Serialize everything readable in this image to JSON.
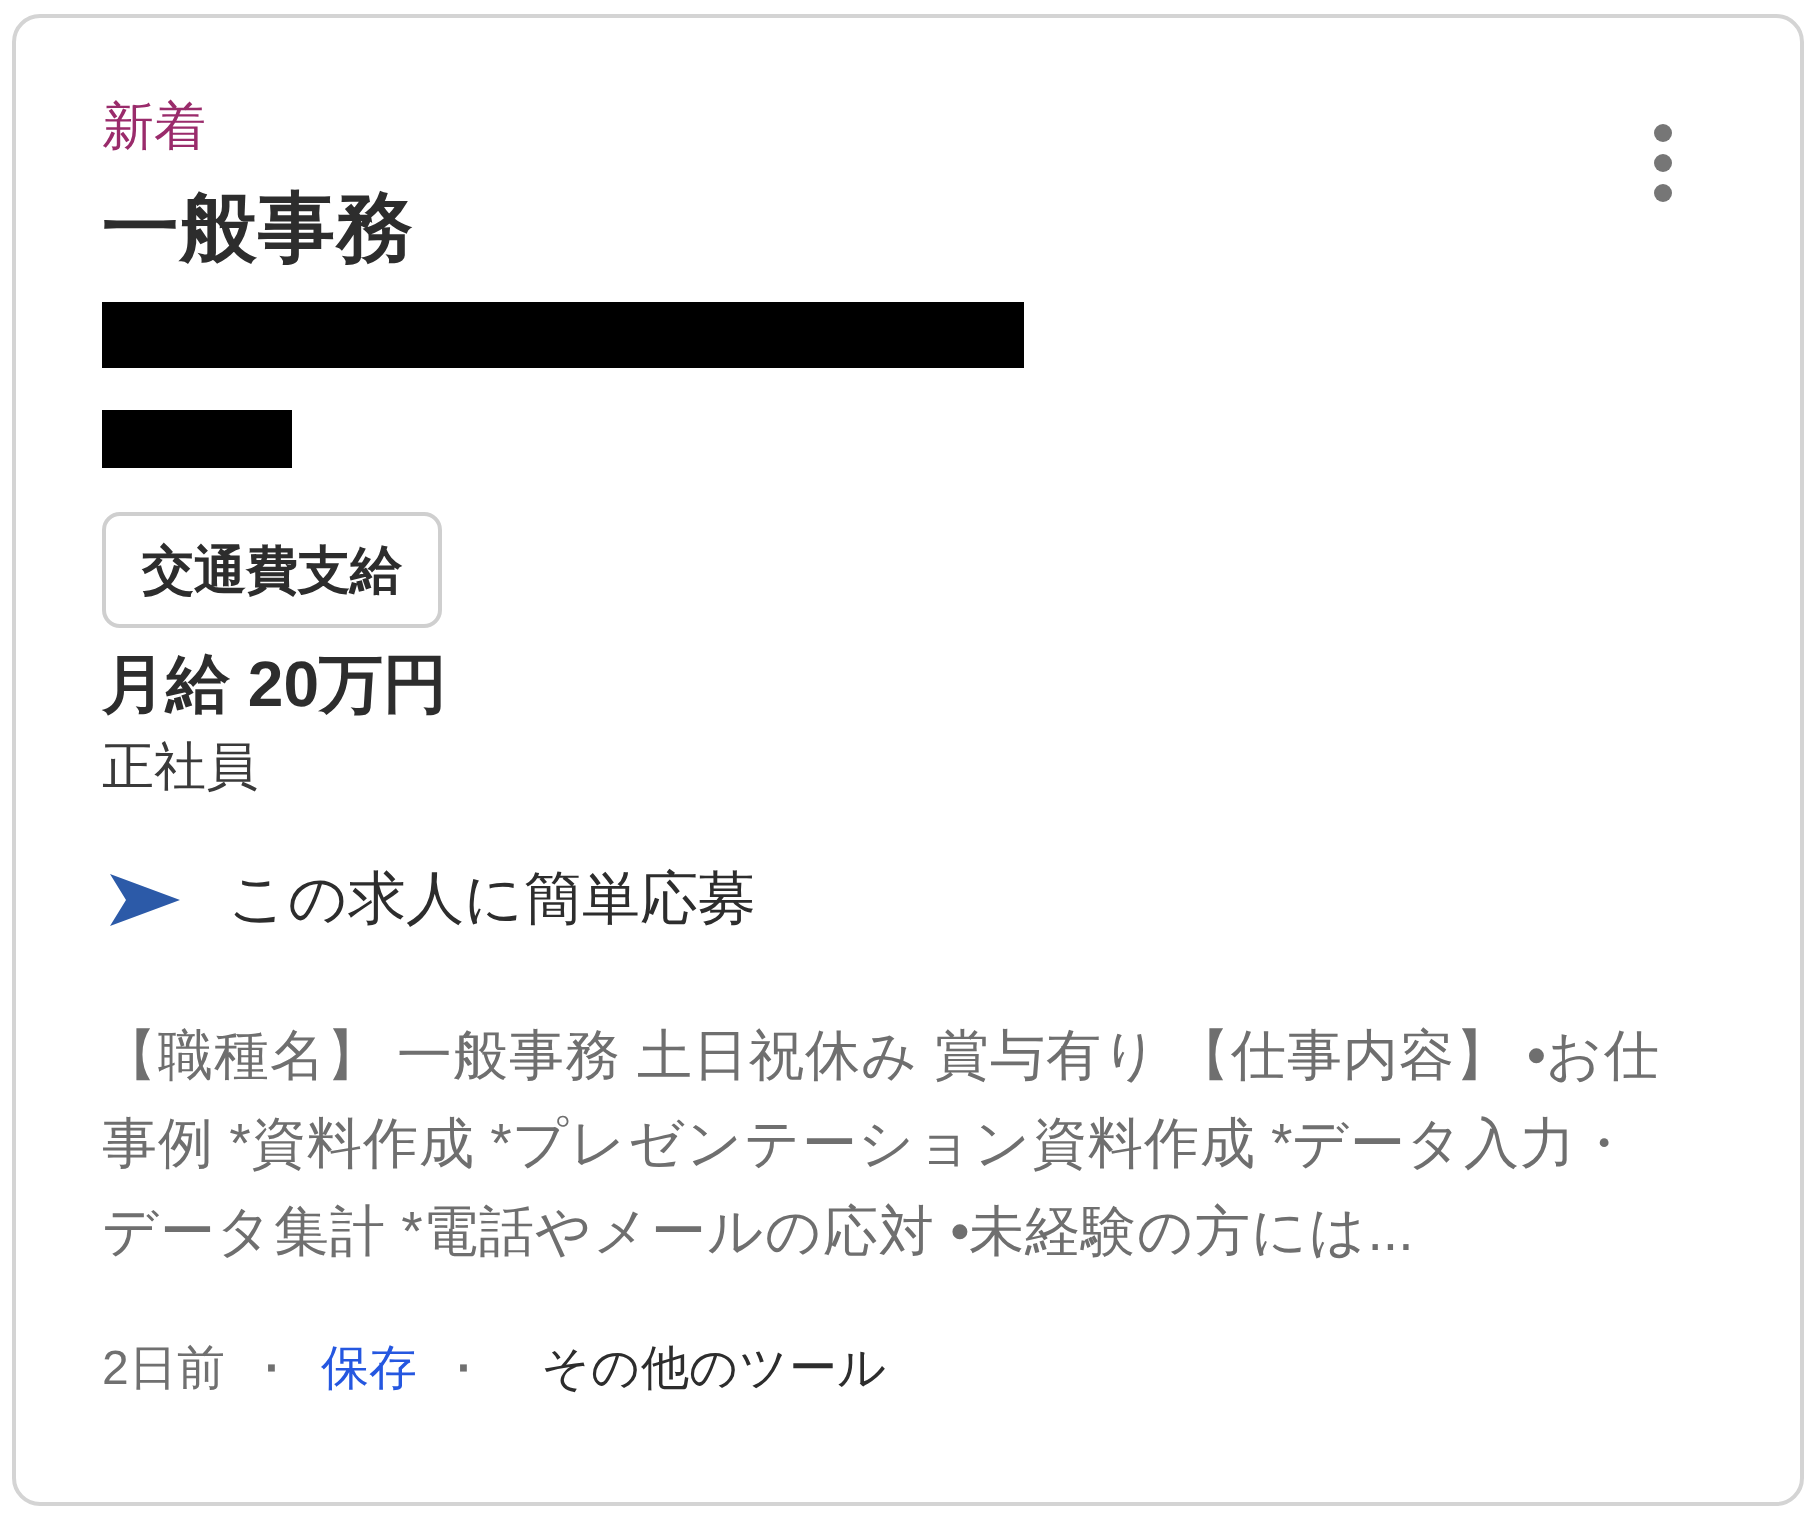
{
  "card": {
    "label": "新着",
    "title": "一般事務",
    "tags": [
      "交通費支給"
    ],
    "salary": "月給 20万円",
    "employment_type": "正社員",
    "apply": {
      "text": "この求人に簡単応募"
    },
    "description": "【職種名】 一般事務 土日祝休み 賞与有り 【仕事内容】 •お仕事例 *資料作成 *プレゼンテーション資料作成 *データ入力・データ集計 *電話やメールの応対 •未経験の方には...",
    "footer": [
      {
        "kind": "meta",
        "text": "2日前"
      },
      {
        "kind": "separator",
        "text": "·"
      },
      {
        "kind": "link",
        "text": "保存"
      },
      {
        "kind": "separator",
        "text": "·"
      },
      {
        "kind": "menu",
        "text": "その他のツール"
      }
    ]
  }
}
